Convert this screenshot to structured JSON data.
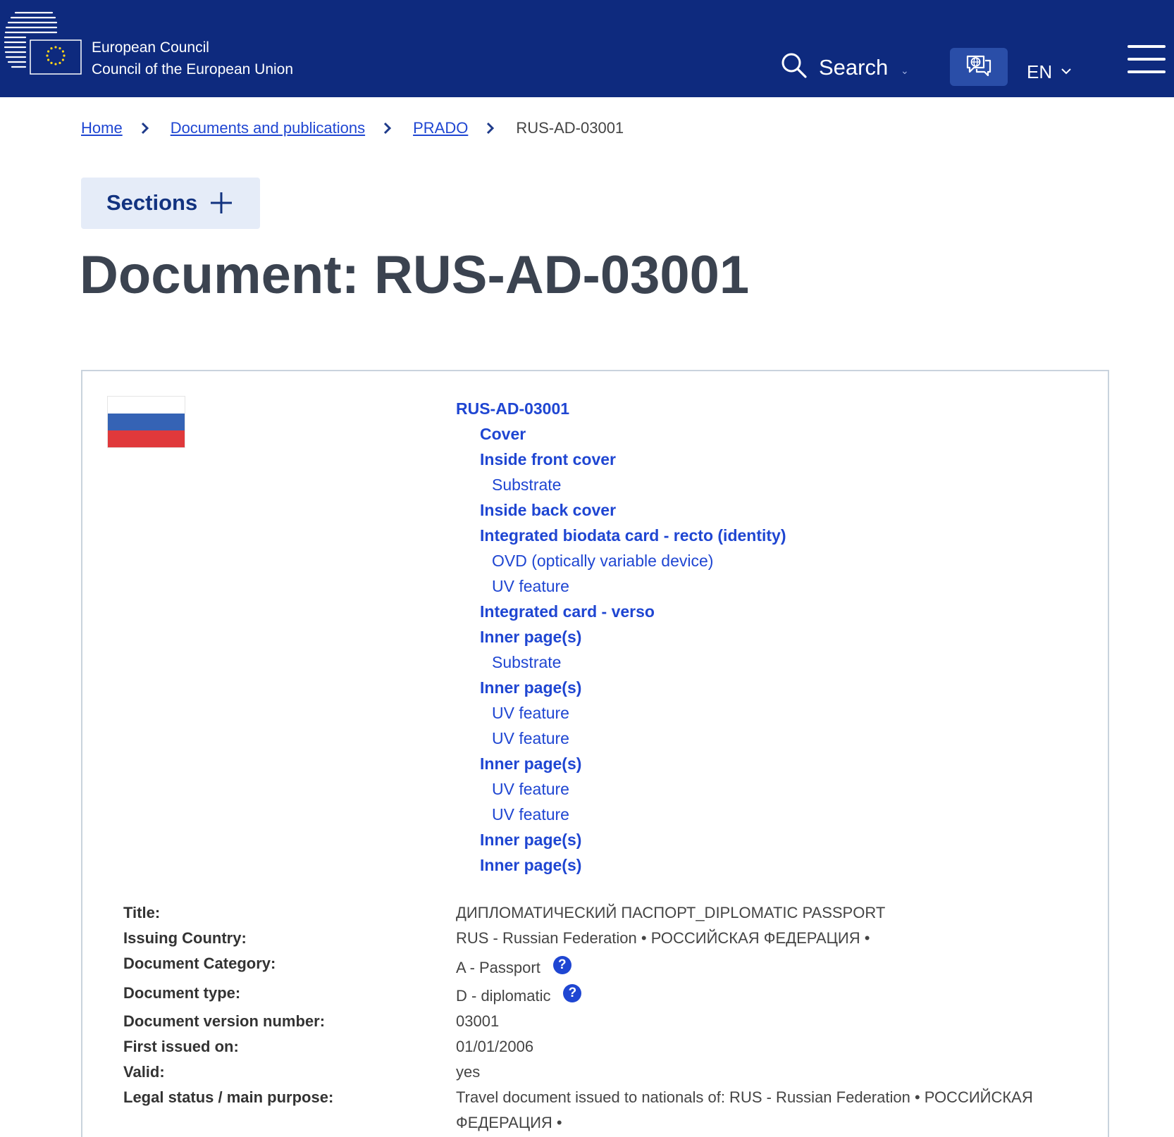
{
  "header": {
    "brand_line1": "European Council",
    "brand_line2": "Council of the European Union",
    "search_label": "Search",
    "search_caret": "⌄",
    "language_label": "EN",
    "colors": {
      "bar": "#0e2a7e",
      "button": "#2a4ea8",
      "link": "#1f46d2"
    }
  },
  "breadcrumb": {
    "home": "Home",
    "documents": "Documents and publications",
    "prado": "PRADO",
    "current": "RUS-AD-03001"
  },
  "sections_label": "Sections",
  "page_title": "Document: RUS-AD-03001",
  "toc": {
    "root": "RUS-AD-03001",
    "items": [
      {
        "label": "Cover",
        "level": 1
      },
      {
        "label": "Inside front cover",
        "level": 1
      },
      {
        "label": "Substrate",
        "level": 2
      },
      {
        "label": "Inside back cover",
        "level": 1
      },
      {
        "label": "Integrated biodata card - recto (identity)",
        "level": 1
      },
      {
        "label": "OVD (optically variable device)",
        "level": 2
      },
      {
        "label": "UV feature",
        "level": 2
      },
      {
        "label": "Integrated card - verso",
        "level": 1
      },
      {
        "label": "Inner page(s)",
        "level": 1
      },
      {
        "label": "Substrate",
        "level": 2
      },
      {
        "label": "Inner page(s)",
        "level": 1
      },
      {
        "label": "UV feature",
        "level": 2
      },
      {
        "label": "UV feature",
        "level": 2
      },
      {
        "label": "Inner page(s)",
        "level": 1
      },
      {
        "label": "UV feature",
        "level": 2
      },
      {
        "label": "UV feature",
        "level": 2
      },
      {
        "label": "Inner page(s)",
        "level": 1
      },
      {
        "label": "Inner page(s)",
        "level": 1
      }
    ]
  },
  "metadata": {
    "title_label": "Title:",
    "title_value": "ДИПЛОМАТИЧЕСКИЙ ПАСПОРТ_DIPLOMATIC PASSPORT",
    "issuing_label": "Issuing Country:",
    "issuing_value": "RUS - Russian Federation • РОССИЙСКАЯ ФЕДЕРАЦИЯ •",
    "category_label": "Document Category:",
    "category_value": "A - Passport",
    "type_label": "Document type:",
    "type_value": "D - diplomatic",
    "version_label": "Document version number:",
    "version_value": "03001",
    "issued_label": "First issued on:",
    "issued_value": "01/01/2006",
    "valid_label": "Valid:",
    "valid_value": "yes",
    "legal_label": "Legal status / main purpose:",
    "legal_value": "Travel document issued to nationals of: RUS - Russian Federation • РОССИЙСКАЯ ФЕДЕРАЦИЯ •",
    "help_glyph": "?"
  }
}
